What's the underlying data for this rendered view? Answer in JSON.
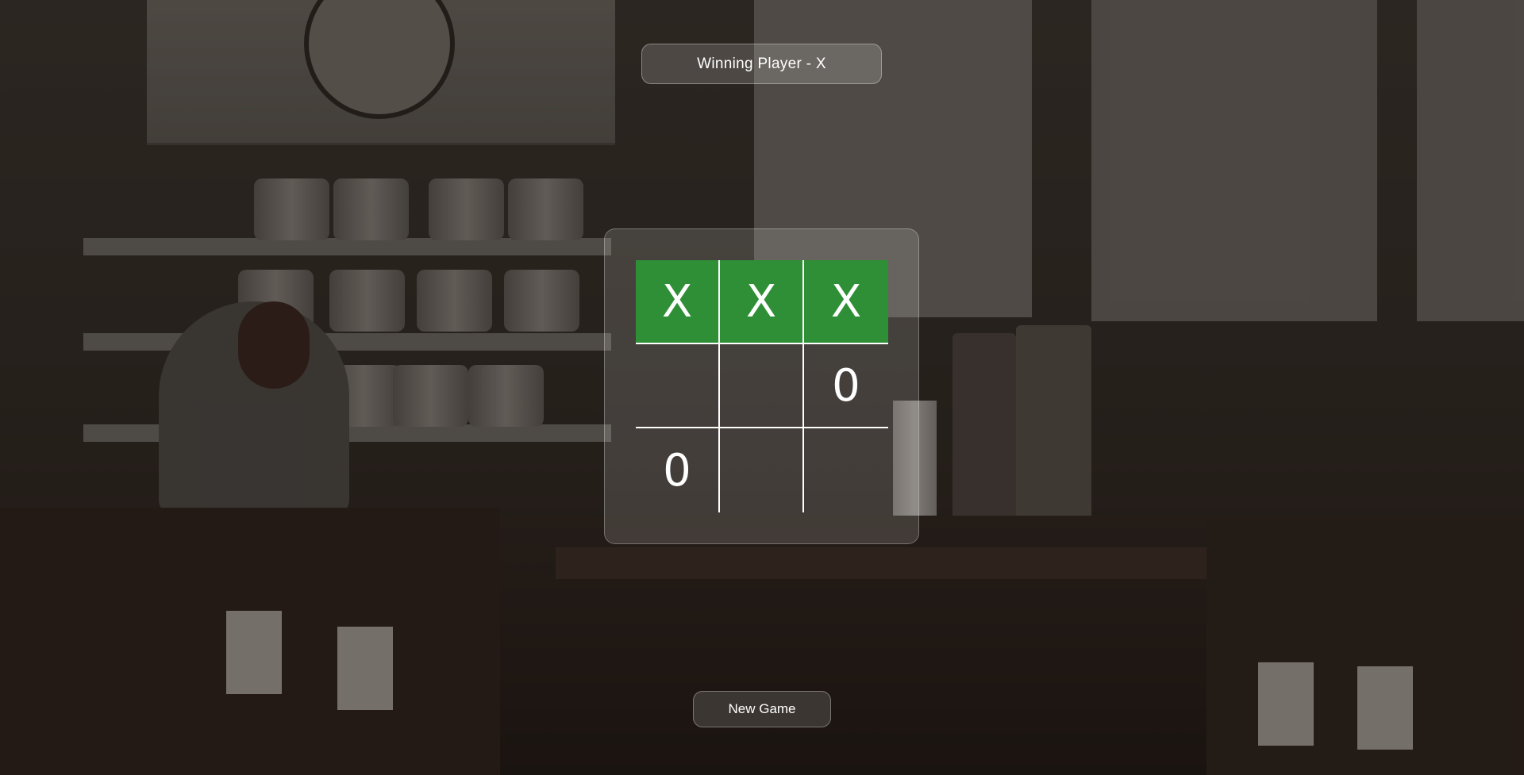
{
  "status": {
    "winner_text": "Winning Player - X"
  },
  "board": {
    "cells": [
      "X",
      "X",
      "X",
      "",
      "",
      "0",
      "0",
      "",
      ""
    ],
    "winning_line": [
      0,
      1,
      2
    ]
  },
  "controls": {
    "new_game_label": "New Game"
  },
  "colors": {
    "win_highlight": "#2f8f36",
    "text": "#ffffff"
  }
}
